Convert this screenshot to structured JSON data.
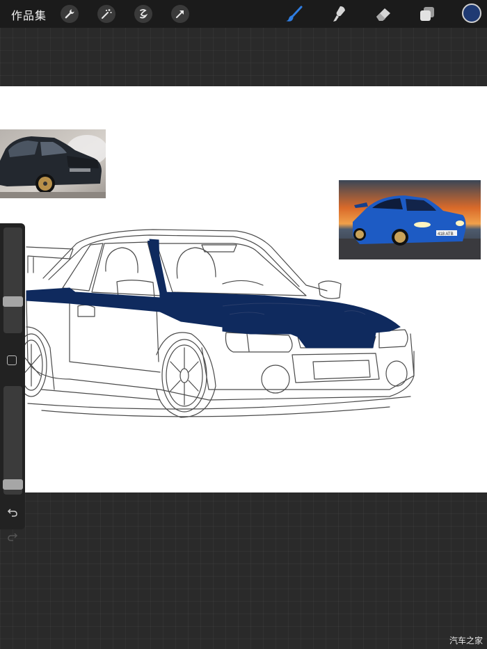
{
  "toolbar": {
    "gallery_label": "作品集",
    "left_tools": [
      {
        "icon": "wrench-icon"
      },
      {
        "icon": "magic-wand-icon"
      },
      {
        "icon": "selection-icon"
      },
      {
        "icon": "transform-arrow-icon"
      }
    ],
    "right_tools": [
      {
        "icon": "brush-icon",
        "active": true
      },
      {
        "icon": "smudge-icon",
        "active": false
      },
      {
        "icon": "eraser-icon",
        "active": false
      },
      {
        "icon": "layers-icon",
        "active": false
      }
    ],
    "current_color": "#1f3a73"
  },
  "canvas": {
    "paint_color": "#0f2a5e",
    "reference_photos": [
      {
        "name": "dark-car-model-photo"
      },
      {
        "name": "blue-subaru-sunset-photo",
        "plate_text": "418 ATB"
      }
    ]
  },
  "sidebar": {
    "brush_size_level": 0.28,
    "opacity_level": 0.05
  },
  "watermark": "汽车之家",
  "colors": {
    "accent_blue": "#2f7de1",
    "toolbar_bg": "#1b1b1b",
    "workspace_bg": "#2a2a2a"
  }
}
